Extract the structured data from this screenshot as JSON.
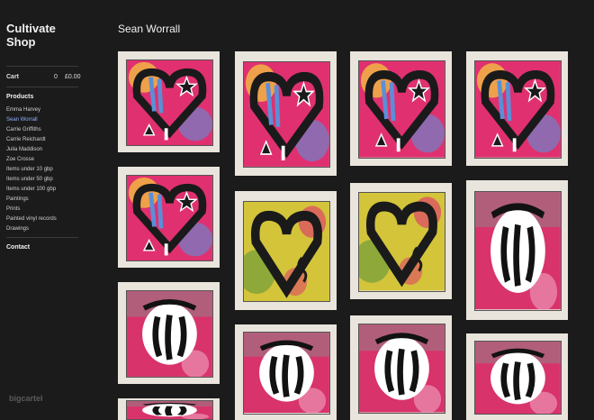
{
  "brand": {
    "line1": "Cultivate",
    "line2": "Shop"
  },
  "cart": {
    "label": "Cart",
    "count": "0",
    "total": "£0.00"
  },
  "products": {
    "heading": "Products",
    "items": [
      "Emma Harvey",
      "Sean Worrall",
      "Carrie Griffiths",
      "Carrie Reichardt",
      "Julia Maddison",
      "Zoe Crosse",
      "Items under 10 gbp",
      "Items under 50 gbp",
      "Items under 100 gbp",
      "Paintings",
      "Prints",
      "Painted vinyl records",
      "Drawings"
    ],
    "active_index": 1
  },
  "contact": {
    "label": "Contact"
  },
  "footer": {
    "logo": "bigcartel"
  },
  "page": {
    "title": "Sean Worrall"
  },
  "gallery_icons": [
    "painting-hearts-stars",
    "painting-heart-green",
    "painting-faces"
  ],
  "colors": {
    "background": "#1b1b1b",
    "active_link": "#8fb3ff",
    "tile_frame": "#e9e4dc"
  }
}
